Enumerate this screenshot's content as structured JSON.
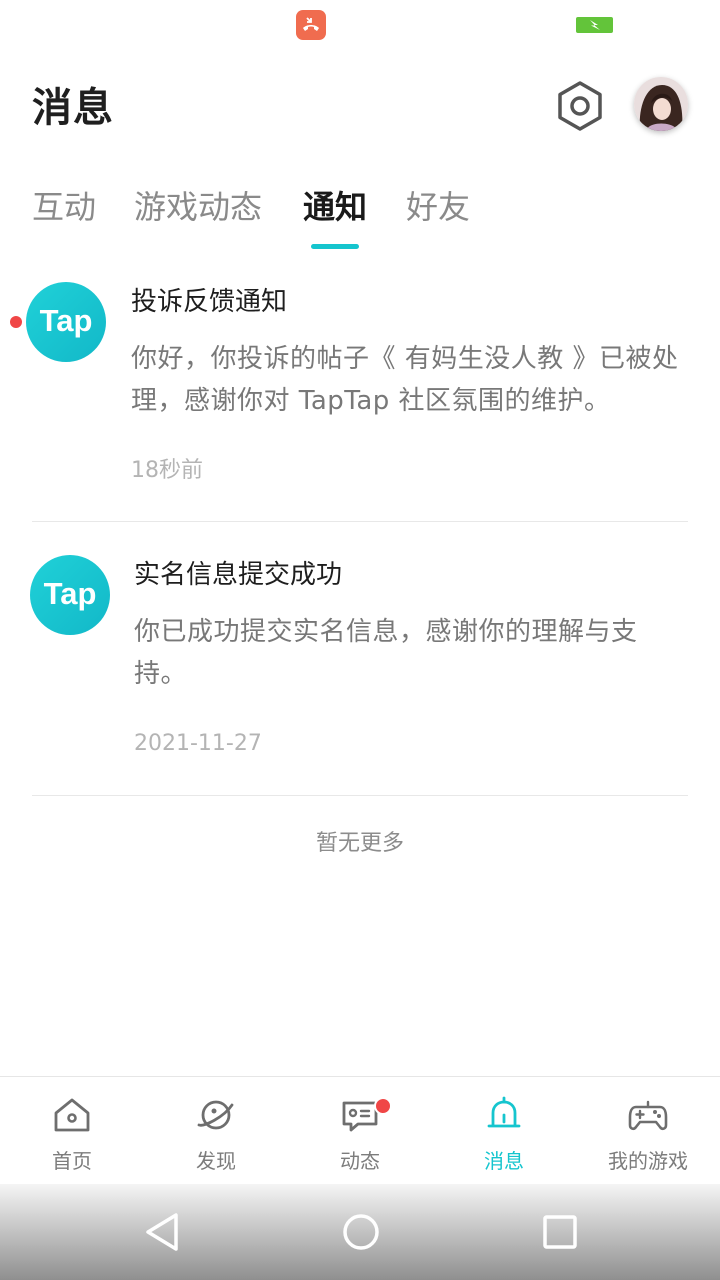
{
  "status_bar": {
    "call_icon": "call-icon",
    "battery_icon": "battery-charging-icon"
  },
  "header": {
    "title": "消息",
    "settings_icon": "settings-hexagon-icon",
    "avatar": "user-avatar"
  },
  "tabs": [
    {
      "label": "互动",
      "active": false
    },
    {
      "label": "游戏动态",
      "active": false
    },
    {
      "label": "通知",
      "active": true
    },
    {
      "label": "好友",
      "active": false
    }
  ],
  "notifications": [
    {
      "logo_text": "Tap",
      "unread": true,
      "title": "投诉反馈通知",
      "body": "你好，你投诉的帖子《 有妈生没人教 》已被处理，感谢你对 TapTap 社区氛围的维护。",
      "time": "18秒前"
    },
    {
      "logo_text": "Tap",
      "unread": false,
      "title": "实名信息提交成功",
      "body": "你已成功提交实名信息，感谢你的理解与支持。",
      "time": "2021-11-27"
    }
  ],
  "footer_text": "暂无更多",
  "bottom_nav": [
    {
      "label": "首页",
      "icon": "home-icon",
      "active": false
    },
    {
      "label": "发现",
      "icon": "planet-icon",
      "active": false
    },
    {
      "label": "动态",
      "icon": "chat-icon",
      "active": false,
      "badge": true
    },
    {
      "label": "消息",
      "icon": "bell-icon",
      "active": true
    },
    {
      "label": "我的游戏",
      "icon": "gamepad-icon",
      "active": false
    }
  ],
  "system_nav": [
    "back-icon",
    "home-circle-icon",
    "recents-icon"
  ],
  "colors": {
    "accent": "#15c5ce",
    "unread": "#f04646",
    "logo": "#1cc8d3"
  }
}
